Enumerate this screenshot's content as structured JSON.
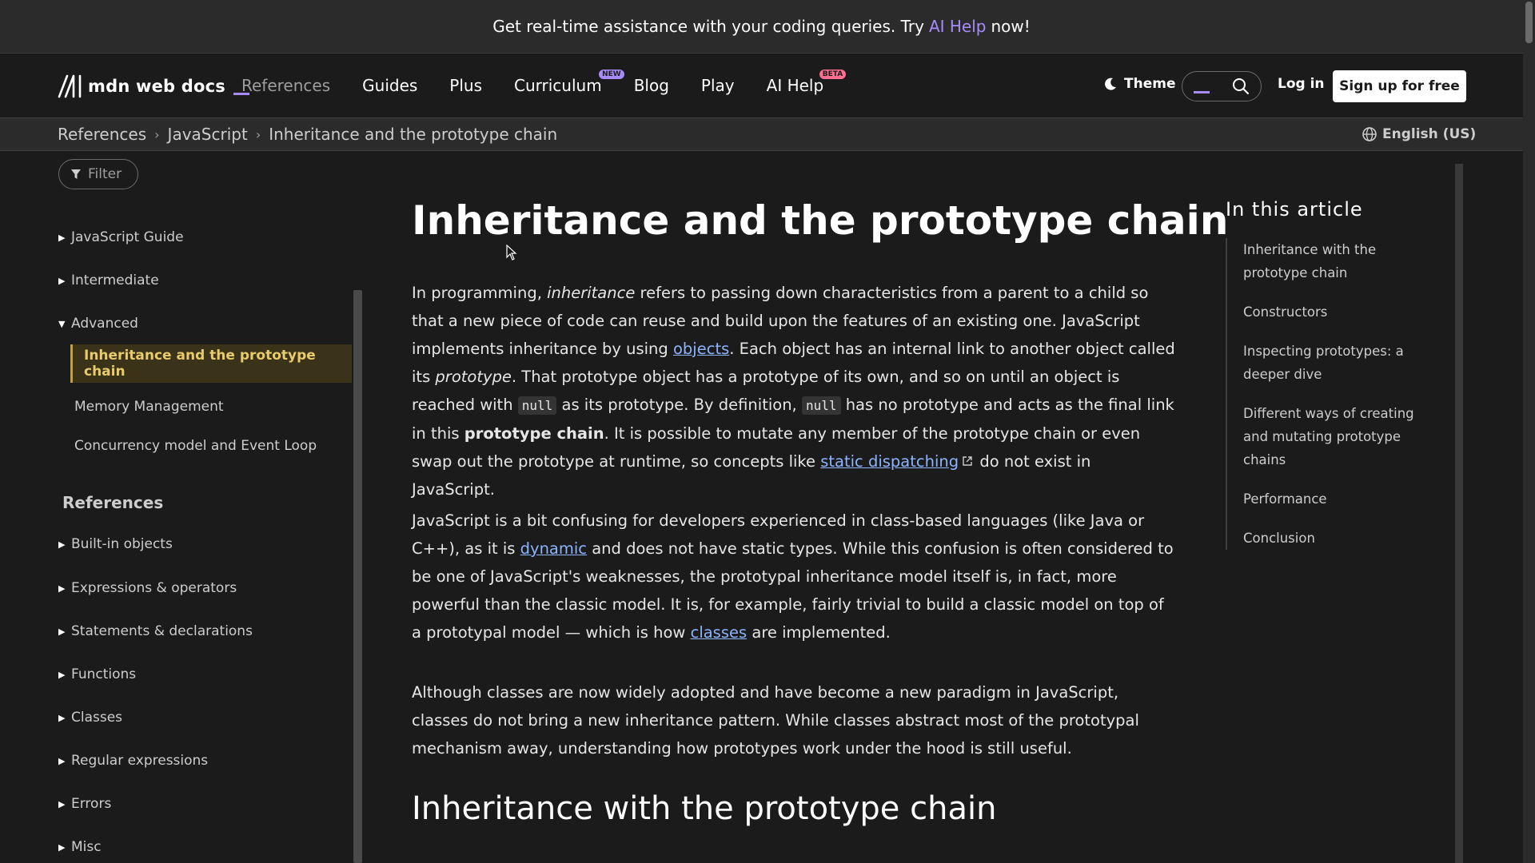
{
  "banner": {
    "text_before": "Get real-time assistance with your coding queries. Try",
    "link": "AI Help",
    "text_after": "now!"
  },
  "header": {
    "logo_text": "mdn web docs",
    "nav": [
      {
        "label": "References"
      },
      {
        "label": "Guides"
      },
      {
        "label": "Plus"
      },
      {
        "label": "Curriculum",
        "badge": "NEW"
      },
      {
        "label": "Blog"
      },
      {
        "label": "Play"
      },
      {
        "label": "AI Help",
        "badge": "BETA"
      }
    ],
    "theme_label": "Theme",
    "login_label": "Log in",
    "signup_label": "Sign up for free"
  },
  "breadcrumb": {
    "items": [
      "References",
      "JavaScript",
      "Inheritance and the prototype chain"
    ],
    "language": "English (US)"
  },
  "sidebar": {
    "filter_placeholder": "Filter",
    "groups": [
      {
        "label": "JavaScript Guide"
      },
      {
        "label": "Intermediate"
      },
      {
        "label": "Advanced"
      }
    ],
    "advanced_children": [
      {
        "label": "Inheritance and the prototype chain"
      },
      {
        "label": "Memory Management"
      },
      {
        "label": "Concurrency model and Event Loop"
      }
    ],
    "references_heading": "References",
    "references": [
      {
        "label": "Built-in objects"
      },
      {
        "label": "Expressions & operators"
      },
      {
        "label": "Statements & declarations"
      },
      {
        "label": "Functions"
      },
      {
        "label": "Classes"
      },
      {
        "label": "Regular expressions"
      },
      {
        "label": "Errors"
      },
      {
        "label": "Misc"
      }
    ]
  },
  "article": {
    "title": "Inheritance and the prototype chain",
    "p1": {
      "t1": "In programming, ",
      "em1": "inheritance",
      "t2": " refers to passing down characteristics from a parent to a child so that a new piece of code can reuse and build upon the features of an existing one. JavaScript implements inheritance by using ",
      "link1": "objects",
      "t3": ". Each object has an internal link to another object called its ",
      "em2": "prototype",
      "t4": ". That prototype object has a prototype of its own, and so on until an object is reached with ",
      "code1": "null",
      "t5": " as its prototype. By definition, ",
      "code2": "null",
      "t6": " has no prototype and acts as the final link in this ",
      "strong1": "prototype chain",
      "t7": ". It is possible to mutate any member of the prototype chain or even swap out the prototype at runtime, so concepts like ",
      "link2": "static dispatching",
      "t8": " do not exist in JavaScript."
    },
    "p2": {
      "t1": "JavaScript is a bit confusing for developers experienced in class-based languages (like Java or C++), as it is ",
      "link1": "dynamic",
      "t2": " and does not have static types. While this confusion is often considered to be one of JavaScript's weaknesses, the prototypal inheritance model itself is, in fact, more powerful than the classic model. It is, for example, fairly trivial to build a classic model on top of a prototypal model — which is how ",
      "link2": "classes",
      "t3": " are implemented."
    },
    "p3": "Although classes are now widely adopted and have become a new paradigm in JavaScript, classes do not bring a new inheritance pattern. While classes abstract most of the prototypal mechanism away, understanding how prototypes work under the hood is still useful.",
    "section_heading": "Inheritance with the prototype chain"
  },
  "toc": {
    "title": "In this article",
    "items": [
      "Inheritance with the prototype chain",
      "Constructors",
      "Inspecting prototypes: a deeper dive",
      "Different ways of creating and mutating prototype chains",
      "Performance",
      "Conclusion"
    ]
  },
  "colors": {
    "accent": "#a78bfa",
    "link": "#8cb4ff",
    "active_sidebar_bg": "#3a3219",
    "active_sidebar_text": "#e8cb6b"
  }
}
